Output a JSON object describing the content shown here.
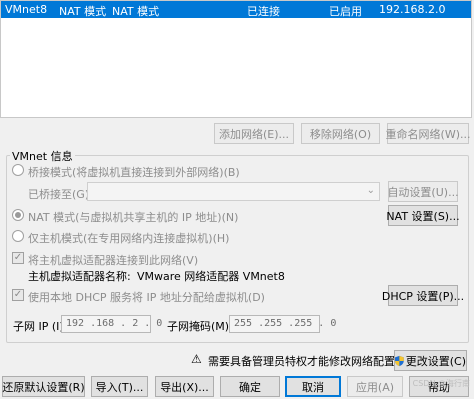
{
  "network_list": {
    "rows": [
      {
        "name": "VMnet8",
        "type": "NAT 模式",
        "external": "NAT 模式",
        "host_connection": "已连接",
        "dhcp": "已启用",
        "subnet": "192.168.2.0"
      }
    ],
    "selected_color": "#0078d7"
  },
  "list_buttons": {
    "add": "添加网络(E)...",
    "remove": "移除网络(O)",
    "rename": "重命名网络(W)..."
  },
  "vmnet_info": {
    "title": "VMnet 信息",
    "bridged_label": "桥接模式(将虚拟机直接连接到外部网络)(B)",
    "bridged_to_label": "已桥接至(G):",
    "bridged_to_value": "",
    "auto_settings": "自动设置(U)...",
    "nat_label": "NAT 模式(与虚拟机共享主机的 IP 地址)(N)",
    "nat_settings": "NAT 设置(S)...",
    "host_only_label": "仅主机模式(在专用网络内连接虚拟机)(H)",
    "connect_adapter_label": "将主机虚拟适配器连接到此网络(V)",
    "adapter_name_label": "主机虚拟适配器名称:",
    "adapter_name_value": "VMware 网络适配器 VMnet8",
    "dhcp_label": "使用本地 DHCP 服务将 IP 地址分配给虚拟机(D)",
    "dhcp_settings": "DHCP 设置(P)...",
    "subnet_ip_label": "子网 IP (I):",
    "subnet_ip_value": "192 .168 . 2  . 0",
    "subnet_mask_label": "子网掩码(M):",
    "subnet_mask_value": "255 .255 .255 . 0"
  },
  "admin_notice": {
    "text": "需要具备管理员特权才能修改网络配置。",
    "change_settings": "更改设置(C)"
  },
  "footer": {
    "restore_defaults": "还原默认设置(R)",
    "import": "导入(T)...",
    "export": "导出(X)...",
    "ok": "确定",
    "cancel": "取消",
    "apply": "应用(A)",
    "help": "帮助"
  },
  "watermark": "CSDN @海行南"
}
